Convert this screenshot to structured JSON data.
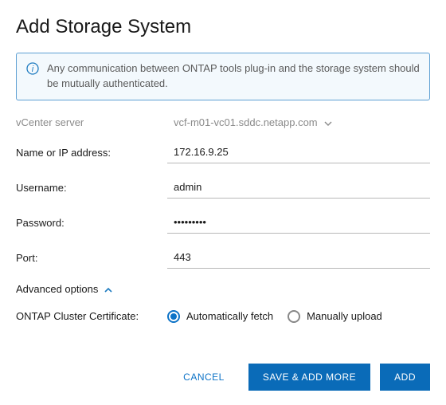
{
  "title": "Add Storage System",
  "info": {
    "text": "Any communication between ONTAP tools plug-in and the storage system should be mutually authenticated."
  },
  "fields": {
    "vcenter_label": "vCenter server",
    "vcenter_value": "vcf-m01-vc01.sddc.netapp.com",
    "name_label": "Name or IP address:",
    "name_value": "172.16.9.25",
    "username_label": "Username:",
    "username_value": "admin",
    "password_label": "Password:",
    "password_value": "•••••••••",
    "port_label": "Port:",
    "port_value": "443"
  },
  "advanced": {
    "toggle_label": "Advanced options",
    "cert_label": "ONTAP Cluster Certificate:",
    "auto_label": "Automatically fetch",
    "manual_label": "Manually upload"
  },
  "footer": {
    "cancel": "CANCEL",
    "save_more": "SAVE & ADD MORE",
    "add": "ADD"
  }
}
